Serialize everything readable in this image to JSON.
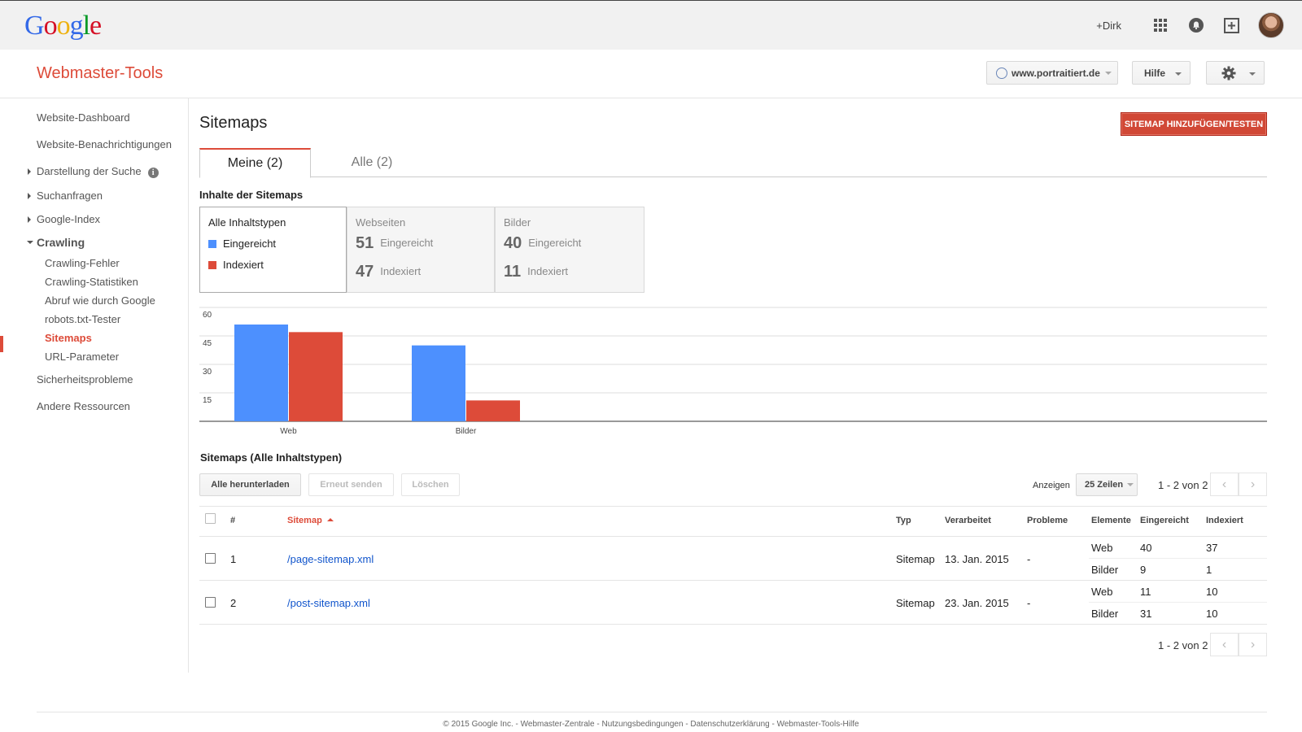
{
  "gbar": {
    "logo_letters": [
      {
        "ch": "G",
        "color": "#3369e8"
      },
      {
        "ch": "o",
        "color": "#d50f25"
      },
      {
        "ch": "o",
        "color": "#eeb211"
      },
      {
        "ch": "g",
        "color": "#3369e8"
      },
      {
        "ch": "l",
        "color": "#009925"
      },
      {
        "ch": "e",
        "color": "#d50f25"
      }
    ],
    "user_link": "+Dirk",
    "icons": [
      "apps-grid-icon",
      "notifications-bell-icon",
      "share-plus-icon"
    ]
  },
  "header": {
    "title": "Webmaster-Tools",
    "site_selector": "www.portraitiert.de",
    "help_label": "Hilfe"
  },
  "sidebar": {
    "items": {
      "dashboard": "Website-Dashboard",
      "notifications": "Website-Benachrichtigungen",
      "search_appearance": "Darstellung der Suche",
      "search_traffic": "Suchanfragen",
      "google_index": "Google-Index",
      "crawling": "Crawling",
      "crawl_errors": "Crawling-Fehler",
      "crawl_stats": "Crawling-Statistiken",
      "fetch_as_google": "Abruf wie durch Google",
      "robots_tester": "robots.txt-Tester",
      "sitemaps": "Sitemaps",
      "url_parameters": "URL-Parameter",
      "security_issues": "Sicherheitsprobleme",
      "other_resources": "Andere Ressourcen"
    }
  },
  "main": {
    "page_title": "Sitemaps",
    "add_test_button": "SITEMAP HINZUFÜGEN/TESTEN",
    "tabs": [
      {
        "label": "Meine (2)",
        "active": true
      },
      {
        "label": "Alle (2)",
        "active": false
      }
    ],
    "contents_title": "Inhalte der Sitemaps",
    "summary": {
      "legend_title": "Alle Inhaltstypen",
      "legend_submitted": "Eingereicht",
      "legend_indexed": "Indexiert",
      "submitted_color": "#4d90fe",
      "indexed_color": "#dd4b39",
      "cards": [
        {
          "title": "Webseiten",
          "submitted": "51",
          "submitted_label": "Eingereicht",
          "indexed": "47",
          "indexed_label": "Indexiert"
        },
        {
          "title": "Bilder",
          "submitted": "40",
          "submitted_label": "Eingereicht",
          "indexed": "11",
          "indexed_label": "Indexiert"
        }
      ]
    },
    "table_title": "Sitemaps (Alle Inhaltstypen)",
    "buttons": {
      "download_all": "Alle herunterladen",
      "resubmit": "Erneut senden",
      "delete": "Löschen"
    },
    "pager": {
      "show_label": "Anzeigen",
      "rows_option": "25 Zeilen",
      "count_top": "1 - 2 von 2",
      "count_bottom": "1 - 2 von 2"
    },
    "table": {
      "headers": {
        "num": "#",
        "sitemap": "Sitemap",
        "type": "Typ",
        "processed": "Verarbeitet",
        "issues": "Probleme",
        "items": "Elemente",
        "submitted": "Eingereicht",
        "indexed": "Indexiert"
      },
      "rows": [
        {
          "num": "1",
          "sitemap": "/page-sitemap.xml",
          "type": "Sitemap",
          "processed": "13. Jan. 2015",
          "issues": "-",
          "details": [
            {
              "item": "Web",
              "submitted": "40",
              "indexed": "37"
            },
            {
              "item": "Bilder",
              "submitted": "9",
              "indexed": "1"
            }
          ]
        },
        {
          "num": "2",
          "sitemap": "/post-sitemap.xml",
          "type": "Sitemap",
          "processed": "23. Jan. 2015",
          "issues": "-",
          "details": [
            {
              "item": "Web",
              "submitted": "11",
              "indexed": "10"
            },
            {
              "item": "Bilder",
              "submitted": "31",
              "indexed": "10"
            }
          ]
        }
      ]
    }
  },
  "chart_data": {
    "type": "bar",
    "categories": [
      "Web",
      "Bilder"
    ],
    "series": [
      {
        "name": "Eingereicht",
        "color": "#4d90fe",
        "values": [
          51,
          40
        ]
      },
      {
        "name": "Indexiert",
        "color": "#dd4b39",
        "values": [
          47,
          11
        ]
      }
    ],
    "yticks": [
      15,
      30,
      45,
      60
    ],
    "ylim": [
      0,
      60
    ],
    "grid": true
  },
  "footer": {
    "text": "© 2015 Google Inc. - Webmaster-Zentrale - Nutzungsbedingungen - Datenschutzerklärung - Webmaster-Tools-Hilfe"
  }
}
